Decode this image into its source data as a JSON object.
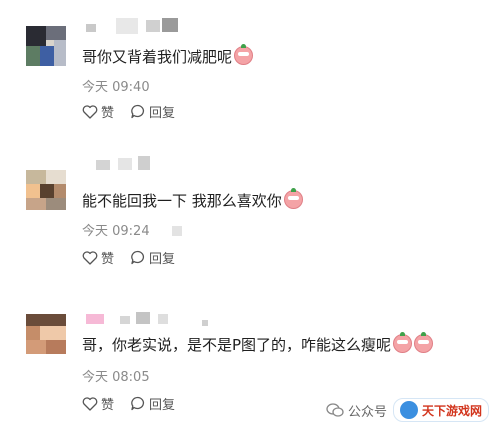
{
  "comments": [
    {
      "text": "哥你又背着我们减肥呢",
      "time": "今天 09:40",
      "like_label": "赞",
      "reply_label": "回复",
      "emoji": "peach-emoji"
    },
    {
      "text": "能不能回我一下 我那么喜欢你",
      "time": "今天 09:24",
      "like_label": "赞",
      "reply_label": "回复",
      "emoji": "peach-emoji"
    },
    {
      "text": "哥，你老实说，是不是P图了的，咋能这么瘦呢",
      "time": "今天 08:05",
      "like_label": "赞",
      "reply_label": "回复",
      "emoji": "peach-emoji"
    }
  ],
  "watermark": {
    "label": "公众号",
    "badge_text": "天下游戏网"
  },
  "colors": {
    "text": "#1f1f1f",
    "meta": "#8a8a8a",
    "action": "#555555",
    "watermark_red": "#d2341c"
  }
}
